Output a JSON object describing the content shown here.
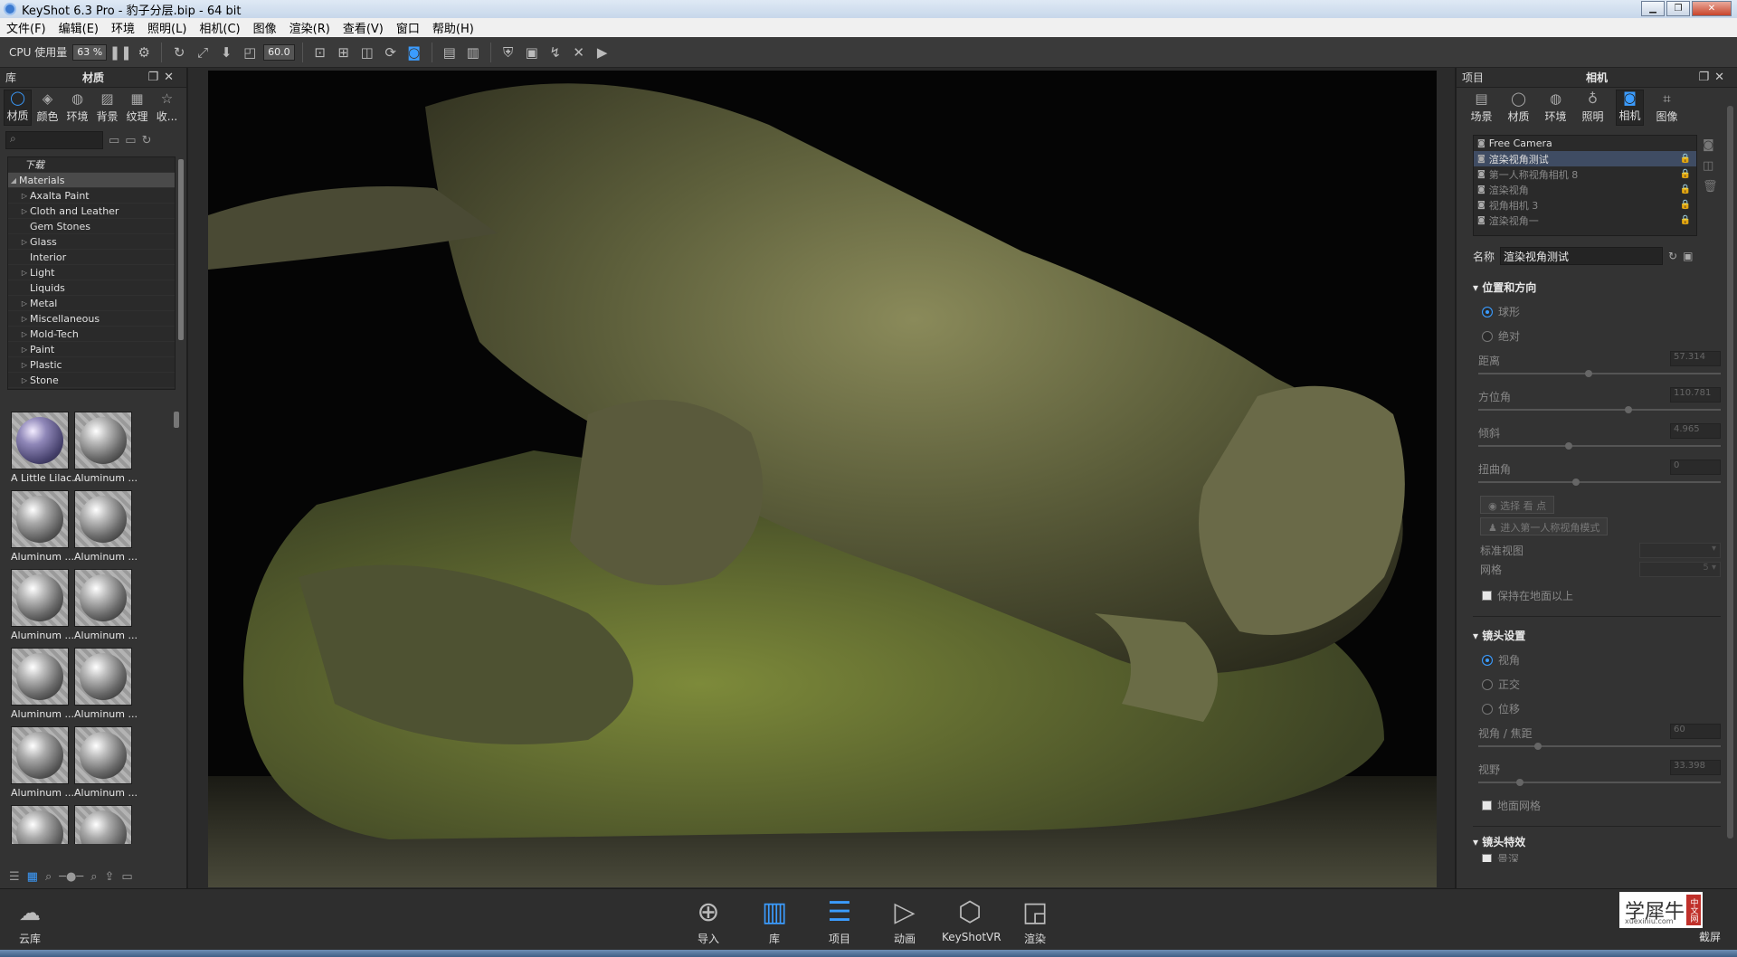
{
  "window": {
    "title": "KeyShot 6.3 Pro  - 豹子分层.bip  - 64 bit",
    "controls": [
      "▁",
      "❐",
      "✕"
    ]
  },
  "menu": [
    "文件(F)",
    "编辑(E)",
    "环境",
    "照明(L)",
    "相机(C)",
    "图像",
    "渲染(R)",
    "查看(V)",
    "窗口",
    "帮助(H)"
  ],
  "toolbar": {
    "cpu_label": "CPU 使用量",
    "cpu_value": "63 %",
    "fov_value": "60.0"
  },
  "left_panel": {
    "header_left": "库",
    "header_title": "材质",
    "tabs": [
      "材质",
      "颜色",
      "环境",
      "背景",
      "纹理",
      "收..."
    ],
    "search_placeholder": "",
    "tree_header": "下载",
    "tree": [
      "Materials",
      "Axalta Paint",
      "Cloth and Leather",
      "Gem Stones",
      "Glass",
      "Interior",
      "Light",
      "Liquids",
      "Metal",
      "Miscellaneous",
      "Mold-Tech",
      "Paint",
      "Plastic",
      "Stone"
    ],
    "thumbnails": [
      "A Little Lilac...",
      "Aluminum ...",
      "Aluminum ...",
      "Aluminum ...",
      "Aluminum ...",
      "Aluminum ...",
      "Aluminum ...",
      "Aluminum ...",
      "Aluminum ...",
      "Aluminum ..."
    ]
  },
  "right_panel": {
    "header_left": "项目",
    "header_title": "相机",
    "tabs": [
      "场景",
      "材质",
      "环境",
      "照明",
      "相机",
      "图像"
    ],
    "cameras": [
      "Free Camera",
      "渲染视角测试",
      "第一人称视角相机 8",
      "渲染视角",
      "视角相机 3",
      "渲染视角一"
    ],
    "name_label": "名称",
    "name_value": "渲染视角测试",
    "section_position": "位置和方向",
    "radio_spherical": "球形",
    "radio_absolute": "绝对",
    "distance_label": "距离",
    "distance_value": "57.314",
    "azimuth_label": "方位角",
    "azimuth_value": "110.781",
    "incline_label": "倾斜",
    "incline_value": "4.965",
    "twist_label": "扭曲角",
    "twist_value": "0",
    "select_lookat": "选择 看 点",
    "first_person_btn": "进入第一人称视角模式",
    "std_view_label": "标准视图",
    "grid_label": "网格",
    "grid_value": "5",
    "keep_above_ground": "保持在地面以上",
    "section_lens": "镜头设置",
    "radio_perspective": "视角",
    "radio_ortho": "正交",
    "radio_shift": "位移",
    "focal_label": "视角 / 焦距",
    "focal_value": "60",
    "fov_label": "视野",
    "fov_value": "33.398",
    "ground_grid": "地面网格",
    "section_effects": "镜头特效",
    "effects_first_item": "景深"
  },
  "bottom": {
    "cloud": "云库",
    "items": [
      "导入",
      "库",
      "项目",
      "动画",
      "KeyShotVR",
      "渲染"
    ],
    "screenshot": "截屏"
  },
  "logo": {
    "text": "学犀牛",
    "badge": "中文网",
    "url": "xuexiniu.com"
  },
  "colors": {
    "accent": "#3b9cff",
    "panel": "#333333",
    "viewport_bg": "#050505"
  }
}
